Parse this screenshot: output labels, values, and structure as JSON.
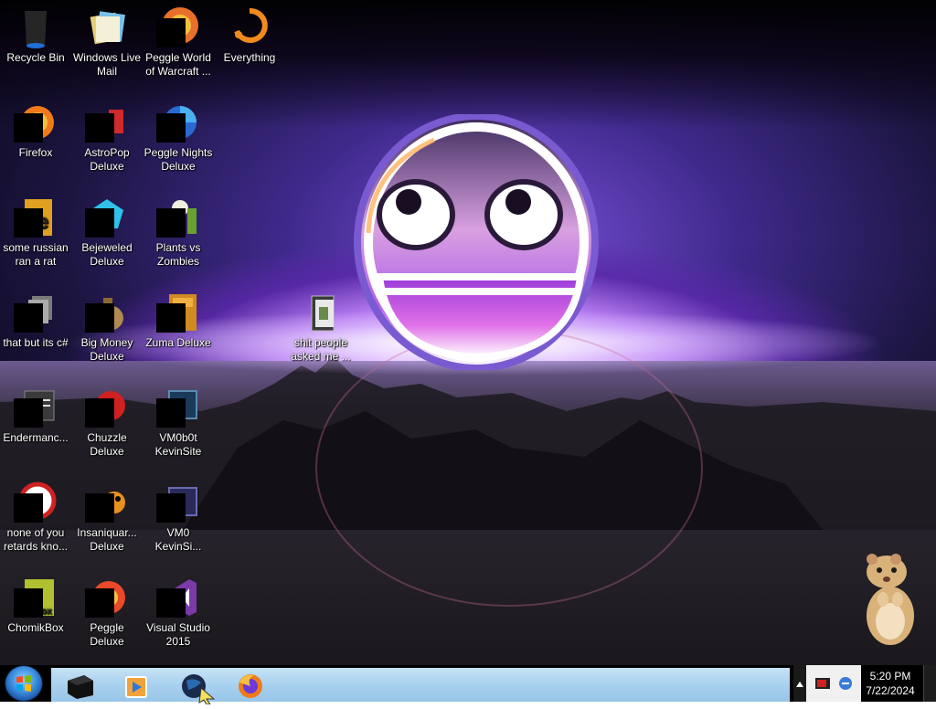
{
  "desktop": {
    "icons": [
      {
        "label": "Recycle Bin",
        "icon": "recycle-bin-icon",
        "color": "#2a2a2a",
        "masked": false
      },
      {
        "label": "Windows Live Mail",
        "icon": "mail-icon",
        "color": "#e9d27a",
        "masked": false
      },
      {
        "label": "Peggle World of Warcraft ...",
        "icon": "peggle-icon",
        "color": "#e8702a",
        "masked": true
      },
      {
        "label": "Everything",
        "icon": "everything-icon",
        "color": "#f08a1e",
        "masked": false
      },
      {
        "label": "Firefox",
        "icon": "firefox-icon",
        "color": "#f07a1a",
        "masked": true
      },
      {
        "label": "AstroPop Deluxe",
        "icon": "astropop-icon",
        "color": "#d02a2a",
        "masked": true
      },
      {
        "label": "Peggle Nights Deluxe",
        "icon": "peggle-nights-icon",
        "color": "#2a6ad0",
        "masked": true
      },
      {
        "label": "some russian ran a rat",
        "icon": "document-icon",
        "color": "#e0a020",
        "masked": true
      },
      {
        "label": "Bejeweled Deluxe",
        "icon": "bejeweled-icon",
        "color": "#30c0e8",
        "masked": true
      },
      {
        "label": "Plants vs Zombies",
        "icon": "plants-vs-zombies-icon",
        "color": "#6aa030",
        "masked": true
      },
      {
        "label": "that but its c#",
        "icon": "files-icon",
        "color": "#9a9a9a",
        "masked": true
      },
      {
        "label": "Big Money Deluxe",
        "icon": "money-bag-icon",
        "color": "#b08a50",
        "masked": true
      },
      {
        "label": "Zuma Deluxe",
        "icon": "zuma-icon",
        "color": "#d08a20",
        "masked": true
      },
      {
        "label": "Endermanc...",
        "icon": "app-window-icon",
        "color": "#4a4a4a",
        "masked": true
      },
      {
        "label": "Chuzzle Deluxe",
        "icon": "chuzzle-icon",
        "color": "#d02020",
        "masked": true
      },
      {
        "label": "VM0b0t KevinSite",
        "icon": "terminal-icon",
        "color": "#1a3a5a",
        "masked": true
      },
      {
        "label": "none of you retards kno...",
        "icon": "app-icon",
        "color": "#d02020",
        "masked": true
      },
      {
        "label": "Insaniquar... Deluxe",
        "icon": "fish-icon",
        "color": "#e89020",
        "masked": true
      },
      {
        "label": "VM0 KevinSi...",
        "icon": "terminal-icon",
        "color": "#2a2a5a",
        "masked": true
      },
      {
        "label": "ChomikBox",
        "icon": "chomikbox-icon",
        "color": "#b0c030",
        "masked": true
      },
      {
        "label": "Peggle Deluxe",
        "icon": "peggle-icon",
        "color": "#e84a2a",
        "masked": true
      },
      {
        "label": "Visual Studio 2015",
        "icon": "visual-studio-icon",
        "color": "#7a3aa8",
        "masked": true
      },
      {
        "label": "shit people asked me ...",
        "icon": "folder-icon",
        "color": "#3a3a3a",
        "masked": false
      }
    ]
  },
  "taskbar": {
    "start_icon": "windows-start-icon",
    "pinned": [
      {
        "name": "taskbar-app-black",
        "icon": "black-box-icon"
      },
      {
        "name": "taskbar-media-player",
        "icon": "media-player-icon"
      },
      {
        "name": "taskbar-globe",
        "icon": "globe-icon"
      },
      {
        "name": "taskbar-firefox",
        "icon": "firefox-icon"
      }
    ],
    "clock": {
      "time": "5:20 PM",
      "date": "7/22/2024"
    }
  },
  "colors": {
    "accent": "#a27be8",
    "taskbar": "#000000",
    "task_area": "#a9d1ee"
  }
}
